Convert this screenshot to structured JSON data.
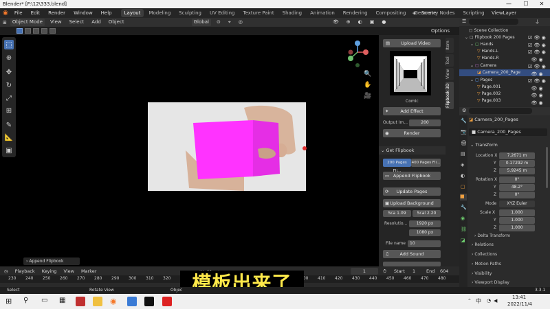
{
  "window": {
    "title": "Blender* [F:\\12\\333.blend]"
  },
  "menu": [
    "File",
    "Edit",
    "Render",
    "Window",
    "Help"
  ],
  "workspaces": [
    "Layout",
    "Modeling",
    "Sculpting",
    "UV Editing",
    "Texture Paint",
    "Shading",
    "Animation",
    "Rendering",
    "Compositing",
    "Geometry Nodes",
    "Scripting"
  ],
  "scene": {
    "label": "Scene",
    "view_layer": "ViewLayer"
  },
  "header": {
    "mode": "Object Mode",
    "items": [
      "View",
      "Select",
      "Add",
      "Object"
    ],
    "orientation": "Global",
    "options": "Options"
  },
  "npanel": {
    "upload_video": "Upload Video",
    "comic_label": "Comic",
    "add_effect": "Add Effect",
    "output_label": "Output Im...",
    "output_value": "200",
    "render": "Render",
    "get_flipbook": "Get Flipbook",
    "pages_tab_a": "200 Pages Fli...",
    "pages_tab_b": "400 Pages Fli...",
    "append_flipbook": "Append Flipbook",
    "update_pages": "Update Pages",
    "upload_background": "Upload Background",
    "sca_label": "Sca",
    "sca_value": "1.09",
    "scal_label": "Scal",
    "scal_value": "2.20",
    "resolution_label": "Resolutio...",
    "res_x": "1920 px",
    "res_y": "1080 px",
    "filename_label": "File name",
    "filename_value": "10",
    "add_sound": "Add Sound",
    "tabs": [
      "Item",
      "Tool",
      "View",
      "Flipbook 3D"
    ]
  },
  "outliner": {
    "rows": [
      {
        "label": "Scene Collection"
      },
      {
        "label": "Flipbook 200 Pages"
      },
      {
        "label": "Hands"
      },
      {
        "label": "Hands.L"
      },
      {
        "label": "Hands.R"
      },
      {
        "label": "Camera"
      },
      {
        "label": "Camera_200_Page"
      },
      {
        "label": "Pages"
      },
      {
        "label": "Page.001"
      },
      {
        "label": "Page.002"
      },
      {
        "label": "Page.003"
      }
    ]
  },
  "properties": {
    "object_name": "Camera_200_Pages",
    "object_name_field": "Camera_200_Pages",
    "transform": "Transform",
    "location_label": "Location X",
    "loc": [
      "7.2671 m",
      "0.17292 m",
      "5.9245 m"
    ],
    "rotation_label": "Rotation X",
    "rot": [
      "0°",
      "48.2°",
      "0°"
    ],
    "mode_label": "Mode",
    "mode_value": "XYZ Euler",
    "scale_label": "Scale X",
    "scale": [
      "1.000",
      "1.000",
      "1.000"
    ],
    "axis": [
      "Y",
      "Z"
    ],
    "delta": "Delta Transform",
    "sections": [
      "Relations",
      "Collections",
      "Motion Paths",
      "Visibility",
      "Viewport Display"
    ]
  },
  "timeline": {
    "items": [
      "Playback",
      "Keying",
      "View",
      "Marker"
    ],
    "current_frame": "1",
    "start_label": "Start",
    "start_value": "1",
    "end_label": "End",
    "end_value": "604",
    "ticks": [
      "230",
      "240",
      "250",
      "260",
      "270",
      "280",
      "290",
      "300",
      "310",
      "320",
      "330",
      "340",
      "350",
      "360",
      "370",
      "380",
      "390",
      "400",
      "410",
      "420",
      "430",
      "440",
      "450",
      "460",
      "470",
      "480"
    ]
  },
  "last_operator": "Append Flipbook",
  "status_bar": {
    "select": "Select",
    "rotate": "Rotate View",
    "object": "Objec",
    "version": "3.3.1"
  },
  "subtitle": "模板出来了",
  "taskbar": {
    "time": "13:41",
    "date": "2022/11/4",
    "lang": "中"
  },
  "colors": {
    "accent": "#4772b3",
    "magenta": "#ff33ff",
    "subtitle": "#ffe94a"
  }
}
